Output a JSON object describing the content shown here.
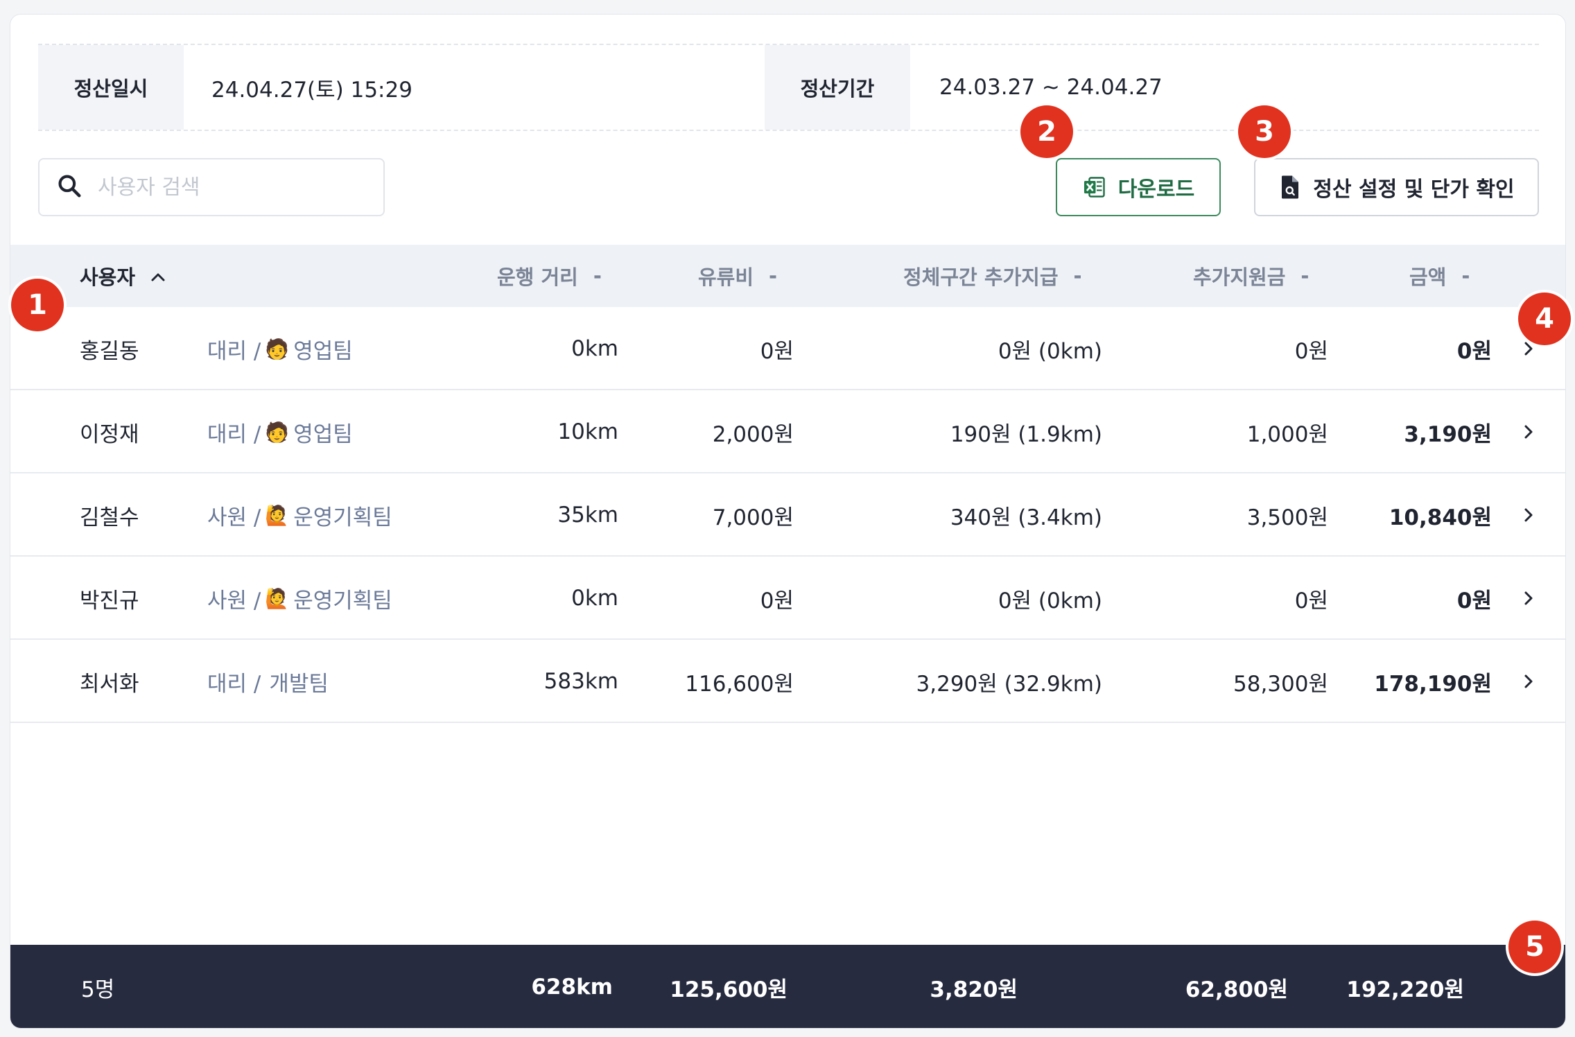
{
  "info": {
    "settle_datetime_label": "정산일시",
    "settle_datetime_value": "24.04.27(토) 15:29",
    "settle_period_label": "정산기간",
    "settle_period_value": "24.03.27 ~ 24.04.27"
  },
  "toolbar": {
    "search_placeholder": "사용자 검색",
    "download_label": "다운로드",
    "settings_label": "정산 설정 및 단가 확인"
  },
  "table": {
    "headers": {
      "user": "사용자",
      "distance": "운행 거리",
      "fuel": "유류비",
      "jam_pay": "정체구간 추가지급",
      "extra_support": "추가지원금",
      "amount": "금액"
    },
    "sort_indicators": {
      "user": "^",
      "others": "-"
    },
    "rows": [
      {
        "name": "홍길동",
        "rank": "대리 /",
        "emoji": "🧑",
        "team": "영업팀",
        "distance": "0km",
        "fuel": "0원",
        "jam": "0원 (0km)",
        "extra": "0원",
        "total": "0원"
      },
      {
        "name": "이정재",
        "rank": "대리 /",
        "emoji": "🧑",
        "team": "영업팀",
        "distance": "10km",
        "fuel": "2,000원",
        "jam": "190원 (1.9km)",
        "extra": "1,000원",
        "total": "3,190원"
      },
      {
        "name": "김철수",
        "rank": "사원 /",
        "emoji": "🙋",
        "team": "운영기획팀",
        "distance": "35km",
        "fuel": "7,000원",
        "jam": "340원 (3.4km)",
        "extra": "3,500원",
        "total": "10,840원"
      },
      {
        "name": "박진규",
        "rank": "사원 /",
        "emoji": "🙋",
        "team": "운영기획팀",
        "distance": "0km",
        "fuel": "0원",
        "jam": "0원 (0km)",
        "extra": "0원",
        "total": "0원"
      },
      {
        "name": "최서화",
        "rank": "대리 /",
        "emoji": "",
        "team": "개발팀",
        "distance": "583km",
        "fuel": "116,600원",
        "jam": "3,290원 (32.9km)",
        "extra": "58,300원",
        "total": "178,190원"
      }
    ]
  },
  "footer": {
    "count": "5명",
    "distance": "628km",
    "fuel": "125,600원",
    "jam": "3,820원",
    "extra": "62,800원",
    "total": "192,220원"
  },
  "markers": [
    "1",
    "2",
    "3",
    "4",
    "5"
  ],
  "colors": {
    "marker_red": "#e0321f",
    "footer_navy": "#262b3f",
    "download_green": "#1f6b43",
    "header_bg": "#eef1f5"
  },
  "icons": {
    "search": "search-icon",
    "excel": "excel-file-icon",
    "document": "document-search-icon",
    "row_arrow": "chevron-right-icon"
  }
}
